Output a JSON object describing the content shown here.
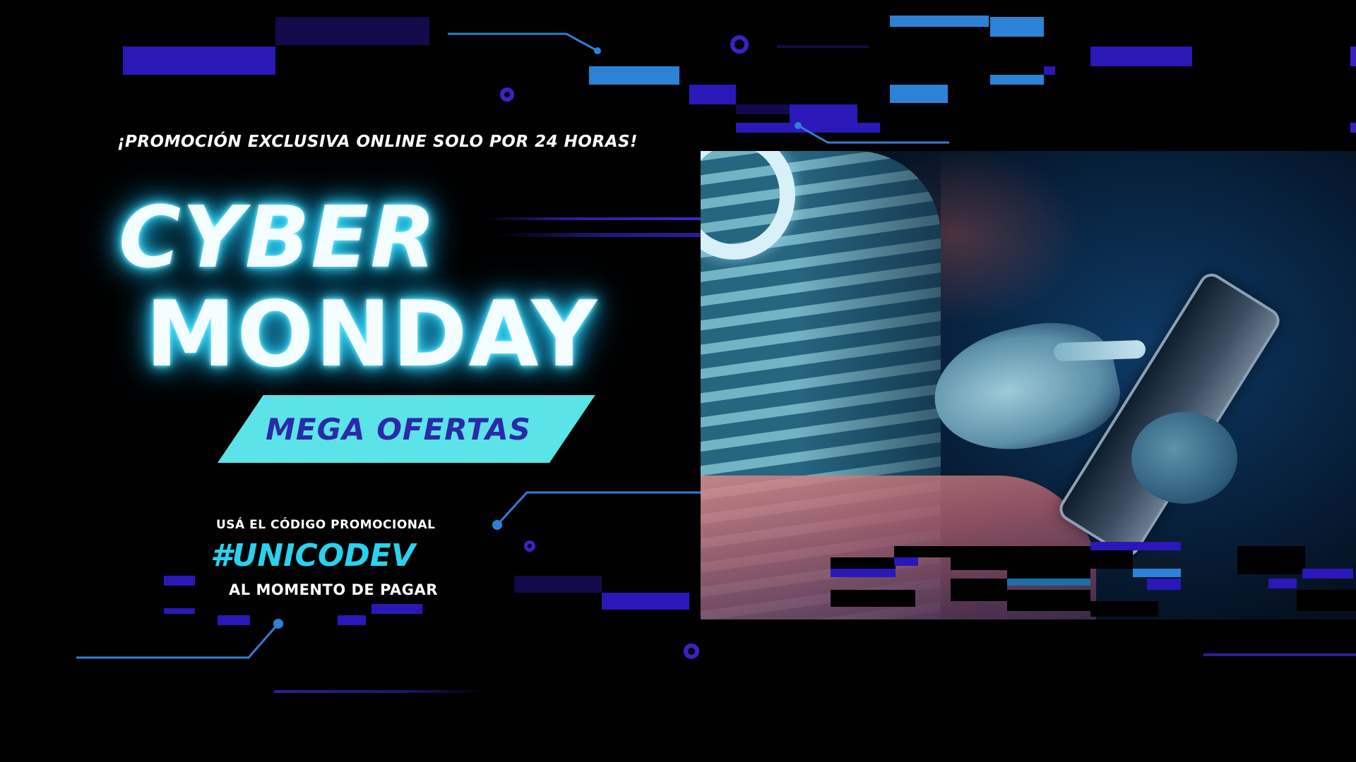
{
  "tagline": "¡PROMOCIÓN EXCLUSIVA ONLINE SOLO POR 24 HORAS!",
  "headline": {
    "line1": "CYBER",
    "line2": "MONDAY"
  },
  "badge": {
    "label": "MEGA OFERTAS"
  },
  "promo": {
    "intro": "USÁ EL CÓDIGO PROMOCIONAL",
    "code": "#UNICODEV",
    "outro": "AL MOMENTO DE PAGAR"
  },
  "photo": {
    "icon": "person-using-tablet-photo"
  },
  "colors": {
    "background": "#000000",
    "neon_text": "#f4fdff",
    "neon_glow": "#22c7f4",
    "badge_fill": "#5be3e8",
    "badge_text": "#2b2aa8",
    "code_text": "#27d3ee",
    "accent_indigo": "#2a18b8",
    "accent_blue": "#2c82d6"
  }
}
